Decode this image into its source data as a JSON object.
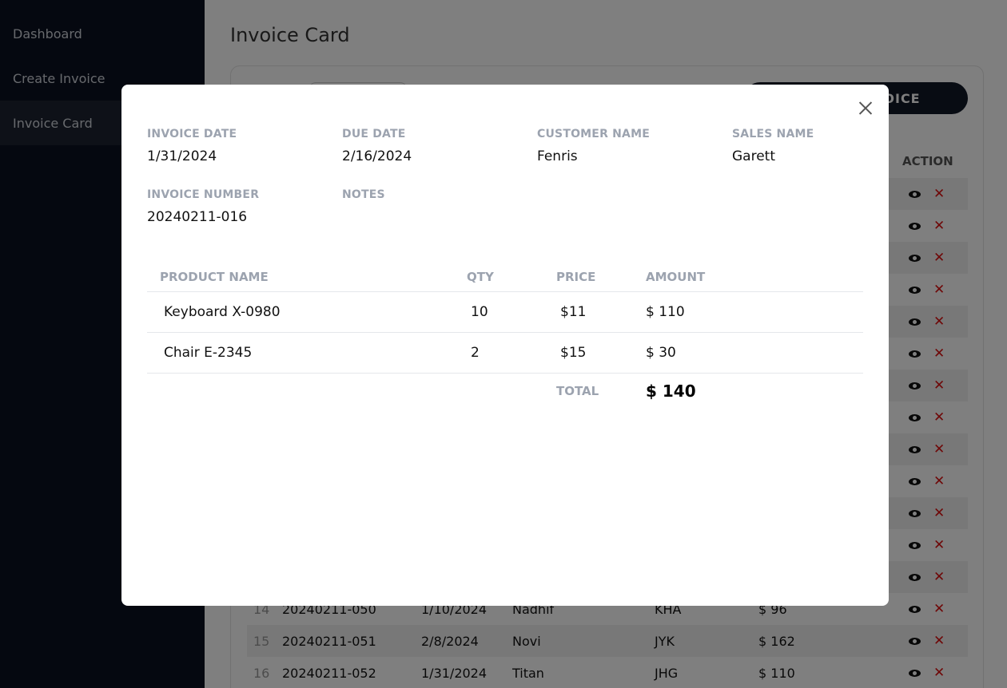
{
  "sidebar": {
    "items": [
      {
        "label": "Dashboard"
      },
      {
        "label": "Create Invoice"
      },
      {
        "label": "Invoice Card"
      }
    ]
  },
  "main": {
    "title": "Invoice Card",
    "create_button": "CREATE INVOICE",
    "col_action": "ACTION",
    "rows": [
      {
        "no": "14",
        "invoice": "20240211-050",
        "date": "1/10/2024",
        "customer": "Nadhif",
        "sales": "KHA",
        "total": "$ 96"
      },
      {
        "no": "15",
        "invoice": "20240211-051",
        "date": "2/8/2024",
        "customer": "Novi",
        "sales": "JYK",
        "total": "$ 162"
      },
      {
        "no": "16",
        "invoice": "20240211-052",
        "date": "1/31/2024",
        "customer": "Titan",
        "sales": "JHG",
        "total": "$ 110"
      }
    ]
  },
  "modal": {
    "invoice_date_label": "INVOICE DATE",
    "invoice_date": "1/31/2024",
    "due_date_label": "DUE DATE",
    "due_date": "2/16/2024",
    "customer_name_label": "CUSTOMER NAME",
    "customer_name": "Fenris",
    "sales_name_label": "SALES NAME",
    "sales_name": "Garett",
    "invoice_number_label": "INVOICE NUMBER",
    "invoice_number": "20240211-016",
    "notes_label": "NOTES",
    "notes": "",
    "table": {
      "headers": [
        "PRODUCT NAME",
        "QTY",
        "PRICE",
        "AMOUNT"
      ],
      "rows": [
        {
          "product": "Keyboard X-0980",
          "qty": "10",
          "price": "$11",
          "amount": "$ 110"
        },
        {
          "product": "Chair E-2345",
          "qty": "2",
          "price": "$15",
          "amount": "$ 30"
        }
      ],
      "total_label": "TOTAL",
      "total_value": "$ 140"
    }
  }
}
